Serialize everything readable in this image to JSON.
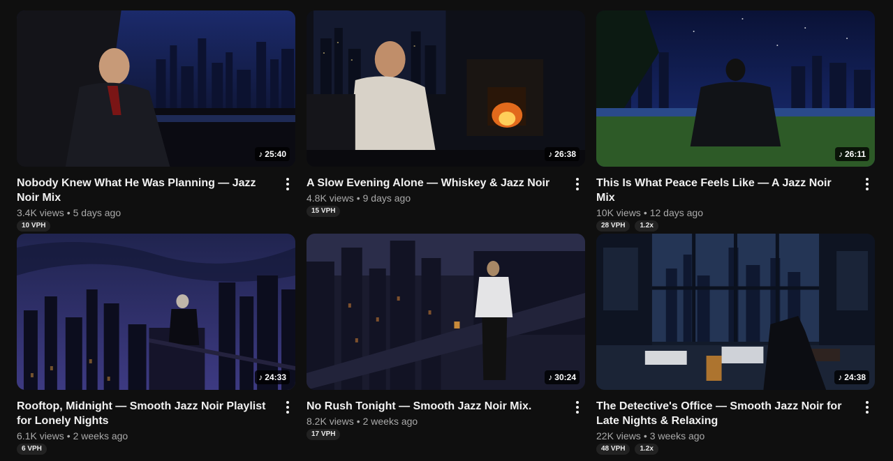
{
  "videos": [
    {
      "title": "Nobody Knew What He Was Planning — Jazz Noir Mix",
      "views": "3.4K views",
      "age": "5 days ago",
      "duration": "25:40",
      "badges": [
        "10 VPH"
      ],
      "palette": {
        "sky": "#1b2a6b",
        "deep": "#0a0d1e",
        "accent": "#2c2c3a"
      }
    },
    {
      "title": "A Slow Evening Alone — Whiskey & Jazz Noir",
      "views": "4.8K views",
      "age": "9 days ago",
      "duration": "26:38",
      "badges": [
        "15 VPH"
      ],
      "palette": {
        "sky": "#1a1f35",
        "deep": "#0b0d14",
        "accent": "#c4561a"
      }
    },
    {
      "title": "This Is What Peace Feels Like — A Jazz Noir Mix",
      "views": "10K views",
      "age": "12 days ago",
      "duration": "26:11",
      "badges": [
        "28 VPH",
        "1.2x"
      ],
      "palette": {
        "sky": "#1c2f7a",
        "deep": "#0a1236",
        "accent": "#2e5a2a"
      }
    },
    {
      "title": "Rooftop, Midnight — Smooth Jazz Noir Playlist for Lonely Nights",
      "views": "6.1K views",
      "age": "2 weeks ago",
      "duration": "24:33",
      "badges": [
        "6 VPH"
      ],
      "palette": {
        "sky": "#2a2f6e",
        "deep": "#0c0d1f",
        "accent": "#3a2f55"
      }
    },
    {
      "title": "No Rush Tonight — Smooth Jazz Noir Mix.",
      "views": "8.2K views",
      "age": "2 weeks ago",
      "duration": "30:24",
      "badges": [
        "17 VPH"
      ],
      "palette": {
        "sky": "#2b2d4a",
        "deep": "#101120",
        "accent": "#8a5a2a"
      }
    },
    {
      "title": "The Detective's Office — Smooth Jazz Noir for Late Nights & Relaxing",
      "views": "22K views",
      "age": "3 weeks ago",
      "duration": "24:38",
      "badges": [
        "48 VPH",
        "1.2x"
      ],
      "palette": {
        "sky": "#243555",
        "deep": "#0e1422",
        "accent": "#3a4b66"
      }
    }
  ],
  "icons": {
    "duration": "music-note-icon",
    "menu": "more-vertical-icon"
  }
}
